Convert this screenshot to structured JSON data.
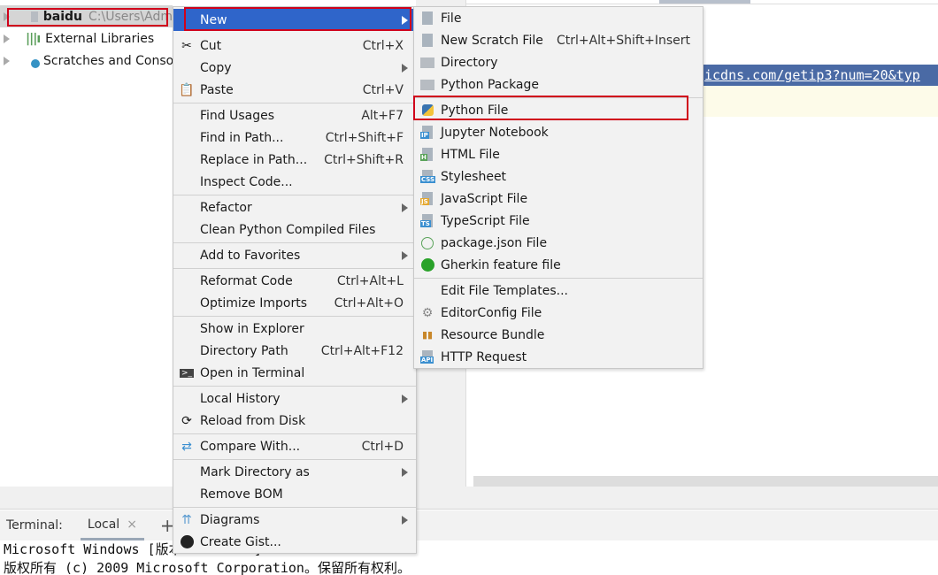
{
  "project_tree": {
    "items": [
      {
        "name": "baidu",
        "path": "C:\\Users\\Adm",
        "icon": "folder-icon"
      },
      {
        "name": "External Libraries",
        "icon": "libraries-icon"
      },
      {
        "name": "Scratches and Consol",
        "icon": "scratches-icon"
      }
    ]
  },
  "editor": {
    "selected_line": "icdns.com/getip3?num=20&typ"
  },
  "context_menu": {
    "new": "New",
    "cut": "Cut",
    "cut_sc": "Ctrl+X",
    "copy": "Copy",
    "paste": "Paste",
    "paste_sc": "Ctrl+V",
    "find_usages": "Find Usages",
    "find_usages_sc": "Alt+F7",
    "find_in_path": "Find in Path...",
    "find_in_path_sc": "Ctrl+Shift+F",
    "replace_in_path": "Replace in Path...",
    "replace_in_path_sc": "Ctrl+Shift+R",
    "inspect": "Inspect Code...",
    "refactor": "Refactor",
    "clean": "Clean Python Compiled Files",
    "favorites": "Add to Favorites",
    "reformat": "Reformat Code",
    "reformat_sc": "Ctrl+Alt+L",
    "optimize": "Optimize Imports",
    "optimize_sc": "Ctrl+Alt+O",
    "show_explorer": "Show in Explorer",
    "dir_path": "Directory Path",
    "dir_path_sc": "Ctrl+Alt+F12",
    "open_terminal": "Open in Terminal",
    "local_history": "Local History",
    "reload": "Reload from Disk",
    "compare": "Compare With...",
    "compare_sc": "Ctrl+D",
    "mark_dir": "Mark Directory as",
    "remove_bom": "Remove BOM",
    "diagrams": "Diagrams",
    "gist": "Create Gist..."
  },
  "new_submenu": {
    "file": "File",
    "scratch": "New Scratch File",
    "scratch_sc": "Ctrl+Alt+Shift+Insert",
    "directory": "Directory",
    "package": "Python Package",
    "python_file": "Python File",
    "jupyter": "Jupyter Notebook",
    "html": "HTML File",
    "stylesheet": "Stylesheet",
    "js": "JavaScript File",
    "ts": "TypeScript File",
    "pkgjson": "package.json File",
    "gherkin": "Gherkin feature file",
    "templates": "Edit File Templates...",
    "editorconfig": "EditorConfig File",
    "bundle": "Resource Bundle",
    "http": "HTTP Request",
    "badges": {
      "jupyter": "IP",
      "html": "H",
      "css": "CSS",
      "js": "JS",
      "ts": "TS",
      "http": "API"
    }
  },
  "terminal": {
    "label": "Terminal:",
    "tab": "Local",
    "close": "×",
    "add": "+",
    "lines": [
      "Microsoft Windows [版本 6.1.7601]",
      "版权所有 (c) 2009 Microsoft Corporation。保留所有权利。"
    ]
  },
  "colors": {
    "highlight": "#2f65ca",
    "annotation": "#d0021b",
    "selection": "#4a6aa5"
  }
}
